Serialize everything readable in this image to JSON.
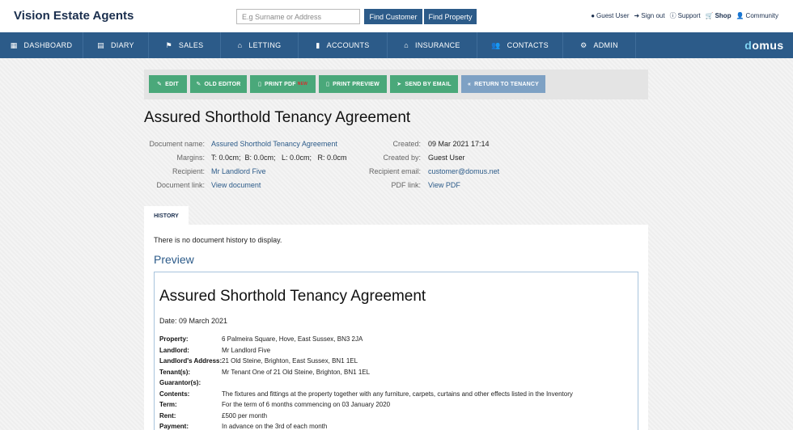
{
  "header": {
    "brand": "Vision Estate Agents",
    "search_placeholder": "E.g Surname or Address",
    "find_customer": "Find Customer",
    "find_property": "Find Property",
    "links": [
      {
        "label": "Guest User",
        "icon": "user-circle-icon",
        "glyph": "●"
      },
      {
        "label": "Sign out",
        "icon": "sign-out-icon",
        "glyph": "➜"
      },
      {
        "label": "Support",
        "icon": "info-icon",
        "glyph": "ⓘ"
      },
      {
        "label": "Shop",
        "icon": "cart-icon",
        "glyph": "🛒"
      },
      {
        "label": "Community",
        "icon": "person-icon",
        "glyph": "👤"
      }
    ]
  },
  "nav": {
    "items": [
      {
        "label": "DASHBOARD",
        "icon": "dashboard-icon",
        "glyph": "▦"
      },
      {
        "label": "DIARY",
        "icon": "calendar-icon",
        "glyph": "▤"
      },
      {
        "label": "SALES",
        "icon": "flag-icon",
        "glyph": "⚑"
      },
      {
        "label": "LETTING",
        "icon": "home-icon",
        "glyph": "⌂"
      },
      {
        "label": "ACCOUNTS",
        "icon": "book-icon",
        "glyph": "▮"
      },
      {
        "label": "INSURANCE",
        "icon": "home-icon",
        "glyph": "⌂"
      },
      {
        "label": "CONTACTS",
        "icon": "users-icon",
        "glyph": "👥"
      },
      {
        "label": "ADMIN",
        "icon": "gear-icon",
        "glyph": "⚙"
      }
    ],
    "logo": {
      "d": "d",
      "rest": "omus"
    }
  },
  "toolbar": {
    "edit": "EDIT",
    "old_editor": "OLD EDITOR",
    "print_pdf": "PRINT PDF",
    "new_badge": "NEW",
    "print_preview": "PRINT PREVIEW",
    "send_by_email": "SEND BY EMAIL",
    "return_to_tenancy": "RETURN TO TENANCY"
  },
  "document": {
    "title": "Assured Shorthold Tenancy Agreement",
    "meta_left": [
      {
        "label": "Document name:",
        "value": "Assured Shorthold Tenancy Agreement",
        "link": true
      },
      {
        "label": "Margins:",
        "value": "T: 0.0cm;  B: 0.0cm;   L: 0.0cm;   R: 0.0cm",
        "link": false
      },
      {
        "label": "Recipient:",
        "value": "Mr Landlord Five",
        "link": true
      },
      {
        "label": "Document link:",
        "value": "View document",
        "link": true
      }
    ],
    "meta_right": [
      {
        "label": "Created:",
        "value": "09 Mar 2021 17:14",
        "link": false
      },
      {
        "label": "Created by:",
        "value": "Guest User",
        "link": false
      },
      {
        "label": "Recipient email:",
        "value": "customer@domus.net",
        "link": true
      },
      {
        "label": "PDF link:",
        "value": "View PDF",
        "link": true
      }
    ]
  },
  "tabs": {
    "history": "HISTORY"
  },
  "history": {
    "empty": "There is no document history to display."
  },
  "preview": {
    "heading": "Preview",
    "title": "Assured Shorthold Tenancy Agreement",
    "date": "Date: 09 March 2021",
    "rows": [
      {
        "label": "Property:",
        "value": "6 Palmeira Square, Hove, East Sussex, BN3 2JA"
      },
      {
        "label": "Landlord:",
        "value": "Mr Landlord Five"
      },
      {
        "label": "Landlord's Address:",
        "value": "21 Old Steine, Brighton, East Sussex, BN1 1EL"
      },
      {
        "label": "Tenant(s):",
        "value": "Mr Tenant One of 21 Old Steine, Brighton, BN1 1EL"
      },
      {
        "label": "Guarantor(s):",
        "value": ""
      },
      {
        "label": "Contents:",
        "value": "The fixtures and fittings at the property together with any furniture, carpets, curtains and other effects listed in the Inventory"
      },
      {
        "label": "Term:",
        "value": "For the term of 6 months commencing on 03 January 2020"
      },
      {
        "label": "Rent:",
        "value": "£500 per month"
      },
      {
        "label": "Payment:",
        "value": "In advance on the 3rd of each month"
      }
    ]
  }
}
